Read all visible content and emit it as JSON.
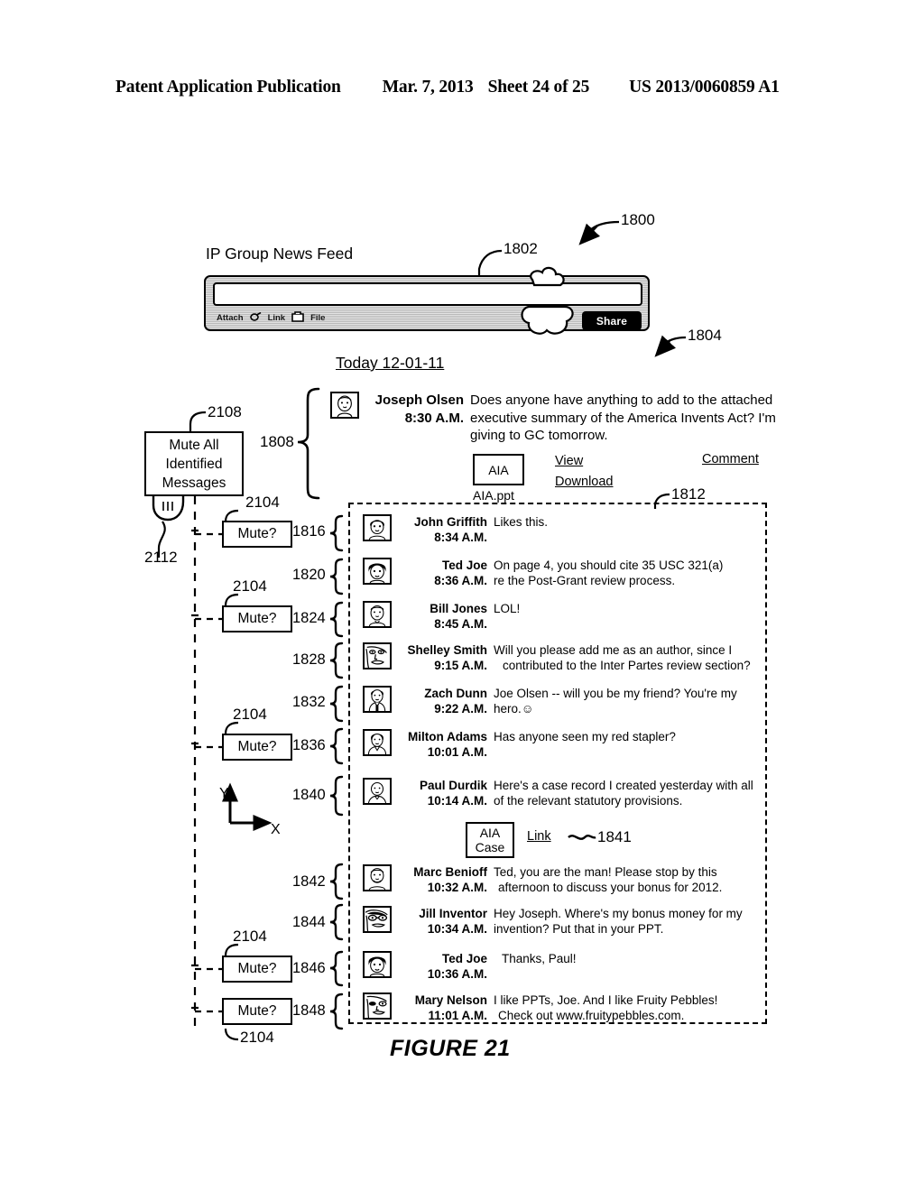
{
  "header": {
    "left": "Patent Application Publication",
    "date": "Mar. 7, 2013",
    "sheet": "Sheet 24 of 25",
    "patent_number": "US 2013/0060859 A1"
  },
  "figure": {
    "caption": "FIGURE 21",
    "axis_x": "X",
    "axis_y": "Y"
  },
  "feed": {
    "title": "IP Group News Feed",
    "composer_value": "",
    "composer_placeholder": "",
    "tools": [
      {
        "label": "Attach",
        "icon": "none"
      },
      {
        "label": "Link",
        "icon": "link-icon"
      },
      {
        "label": "File",
        "icon": "file-icon"
      }
    ],
    "share_label": "Share",
    "date_divider": "Today 12-01-11"
  },
  "controls": {
    "mute_all_label": "Mute All Identified Messages",
    "mute_all_line1": "Mute All",
    "mute_all_line2": "Identified",
    "mute_all_line3": "Messages",
    "mute_label": "Mute?"
  },
  "post": {
    "author": "Joseph Olsen",
    "time": "8:30 A.M.",
    "text_lines": [
      "Does anyone have anything to add to the attached",
      "executive summary of the America Invents Act? I'm",
      "giving to GC tomorrow."
    ],
    "attachment": {
      "box_label": "AIA",
      "caption": "AIA.ppt"
    },
    "actions": {
      "view": "View",
      "download": "Download",
      "comment": "Comment"
    }
  },
  "comments": [
    {
      "ref": "1816",
      "author": "John Griffith",
      "time": "8:34 A.M.",
      "lines": [
        "Likes this."
      ],
      "avatar": "face-john"
    },
    {
      "ref": "1820",
      "author": "Ted Joe",
      "time": "8:36 A.M.",
      "lines": [
        "On page 4, you should cite 35 USC 321(a)",
        "re the Post-Grant review process."
      ],
      "avatar": "face-ted"
    },
    {
      "ref": "1824",
      "author": "Bill Jones",
      "time": "8:45 A.M.",
      "lines": [
        "LOL!"
      ],
      "avatar": "face-bill"
    },
    {
      "ref": "1828",
      "author": "Shelley Smith",
      "time": "9:15 A.M.",
      "lines": [
        "Will you please add me as an author, since I",
        "contributed to the Inter Partes review section?"
      ],
      "avatar": "face-shelley"
    },
    {
      "ref": "1832",
      "author": "Zach Dunn",
      "time": "9:22 A.M.",
      "lines": [
        "Joe Olsen -- will you be my friend? You're my",
        "hero.☺"
      ],
      "avatar": "face-zach"
    },
    {
      "ref": "1836",
      "author": "Milton Adams",
      "time": "10:01 A.M.",
      "lines": [
        "Has anyone seen my red stapler?"
      ],
      "avatar": "face-milton"
    },
    {
      "ref": "1840",
      "author": "Paul Durdik",
      "time": "10:14 A.M.",
      "lines": [
        "Here's a case record I created yesterday with all",
        "of the relevant statutory provisions."
      ],
      "avatar": "face-paul"
    },
    {
      "ref": "1842",
      "author": "Marc Benioff",
      "time": "10:32 A.M.",
      "lines": [
        "Ted, you are the man! Please stop by this",
        "afternoon to discuss your bonus for 2012."
      ],
      "avatar": "face-marc"
    },
    {
      "ref": "1844",
      "author": "Jill Inventor",
      "time": "10:34 A.M.",
      "lines": [
        "Hey Joseph. Where's my bonus money for my",
        "invention? Put that in your PPT."
      ],
      "avatar": "face-jill"
    },
    {
      "ref": "1846",
      "author": "Ted Joe",
      "time": "10:36 A.M.",
      "lines": [
        "Thanks, Paul!"
      ],
      "avatar": "face-ted2"
    },
    {
      "ref": "1848",
      "author": "Mary Nelson",
      "time": "11:01 A.M.",
      "lines": [
        "I like PPTs, Joe. And I like Fruity Pebbles!",
        "Check out www.fruitypebbles.com."
      ],
      "avatar": "face-mary"
    }
  ],
  "case_attachment": {
    "line1": "AIA",
    "line2": "Case",
    "link_label": "Link",
    "ref": "1841"
  },
  "refs": {
    "r1800": "1800",
    "r1802": "1802",
    "r1804": "1804",
    "r1808": "1808",
    "r1812": "1812",
    "r2104_a": "2104",
    "r2104_b": "2104",
    "r2104_c": "2104",
    "r2104_d": "2104",
    "r2104_e": "2104",
    "r2108": "2108",
    "r2112": "2112"
  }
}
